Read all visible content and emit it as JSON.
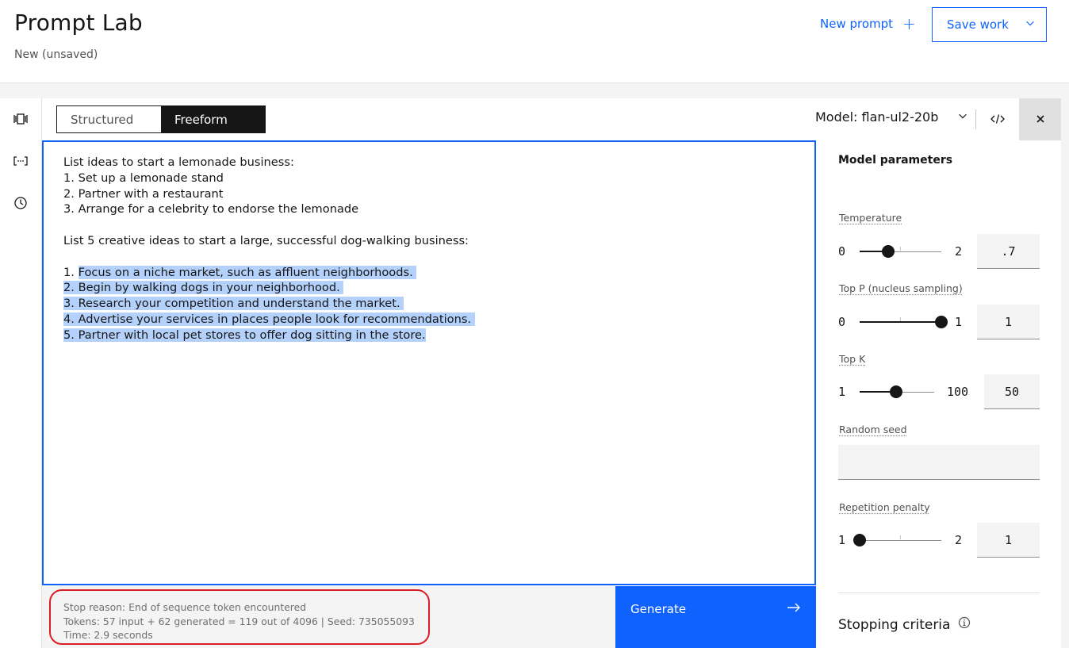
{
  "header": {
    "title": "Prompt Lab",
    "subtitle": "New (unsaved)",
    "new_prompt_label": "New prompt",
    "save_work_label": "Save work"
  },
  "rail": {
    "icons": [
      "sample-prompts-icon",
      "token-variables-icon",
      "history-icon"
    ]
  },
  "toolbar": {
    "modes": [
      "Structured",
      "Freeform"
    ],
    "active_mode": "Freeform",
    "model_label": "Model: flan-ul2-20b"
  },
  "editor": {
    "prompt_lines": [
      "List ideas to start a lemonade business:",
      "1. Set up a lemonade stand",
      "2. Partner with a restaurant",
      "3. Arrange for a celebrity to endorse the lemonade",
      "",
      "List 5 creative ideas to start a large, successful dog-walking business:",
      ""
    ],
    "generated_lines": [
      {
        "num": "1. ",
        "text": "Focus on a niche market, such as affluent neighborhoods. "
      },
      {
        "num": "",
        "text": "2. Begin by walking dogs in your neighborhood. "
      },
      {
        "num": "",
        "text": "3. Research your competition and understand the market. "
      },
      {
        "num": "",
        "text": "4. Advertise your services in places people look for recommendations. "
      },
      {
        "num": "",
        "text": "5. Partner with local pet stores to offer dog sitting in the store."
      }
    ]
  },
  "footer": {
    "stop_reason": "Stop reason: End of sequence token encountered",
    "tokens": "Tokens: 57 input + 62 generated = 119 out of 4096 | Seed: 735055093",
    "time": "Time: 2.9 seconds",
    "generate_label": "Generate"
  },
  "params": {
    "title": "Model parameters",
    "temperature": {
      "label": "Temperature",
      "min": "0",
      "max": "2",
      "value": ".7",
      "fraction": 0.35
    },
    "top_p": {
      "label": "Top P (nucleus sampling)",
      "min": "0",
      "max": "1",
      "value": "1",
      "fraction": 1.0
    },
    "top_k": {
      "label": "Top K",
      "min": "1",
      "max": "100",
      "value": "50",
      "fraction": 0.49
    },
    "random_seed": {
      "label": "Random seed",
      "value": ""
    },
    "repetition_penalty": {
      "label": "Repetition penalty",
      "min": "1",
      "max": "2",
      "value": "1",
      "fraction": 0.0
    },
    "stopping_criteria_label": "Stopping criteria"
  },
  "colors": {
    "accent": "#0f62fe",
    "highlight": "#b3d1fb",
    "annotation": "#da1e28"
  }
}
